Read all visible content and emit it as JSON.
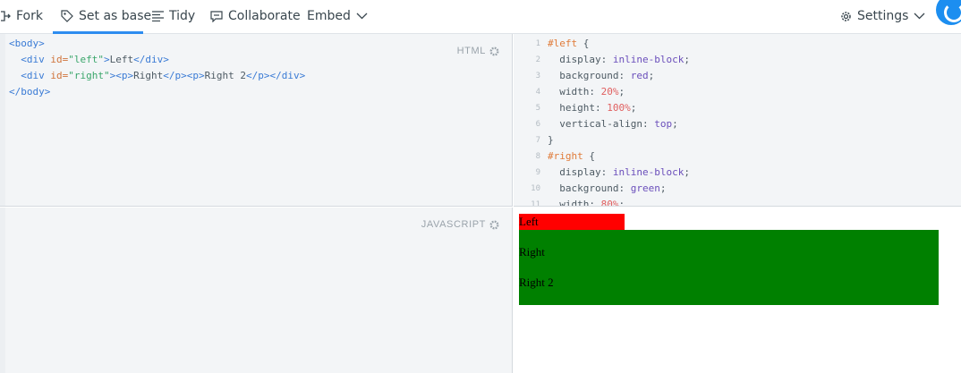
{
  "toolbar": {
    "fork": "Fork",
    "set_as_base": "Set as base",
    "tidy": "Tidy",
    "collaborate": "Collaborate",
    "embed": "Embed",
    "settings": "Settings",
    "accent_color": "#2d8cf0"
  },
  "panels": {
    "html_label": "HTML",
    "js_label": "JAVASCRIPT"
  },
  "html_code": {
    "body_open": "<body>",
    "div_open": "<div",
    "id_attr": " id=",
    "left_id": "\"left\"",
    "right_id": "\"right\"",
    "gt": ">",
    "left_text": "Left",
    "div_close": "</div>",
    "p_open": "<p>",
    "p_close": "</p>",
    "right_text": "Right",
    "right2_text": "Right 2",
    "body_close": "</body>"
  },
  "css_code": {
    "line_numbers": [
      "1",
      "2",
      "3",
      "4",
      "5",
      "6",
      "7",
      "8",
      "9",
      "10",
      "11"
    ],
    "sel_left": "#left",
    "brace_open": " {",
    "brace_close": "}",
    "display_prop": "display: ",
    "inline_block": "inline-block",
    "semicolon": ";",
    "background_prop": "background: ",
    "red": "red",
    "green": "green",
    "width_prop": "width: ",
    "w20": "20%",
    "w80": "80%",
    "height_prop": "height: ",
    "h100": "100%",
    "valign_prop": "vertical-align: ",
    "top": "top",
    "sel_right": "#right"
  },
  "result": {
    "left": "Left",
    "right": "Right",
    "right2": "Right 2",
    "left_color": "#ff0000",
    "right_color": "#008000"
  }
}
